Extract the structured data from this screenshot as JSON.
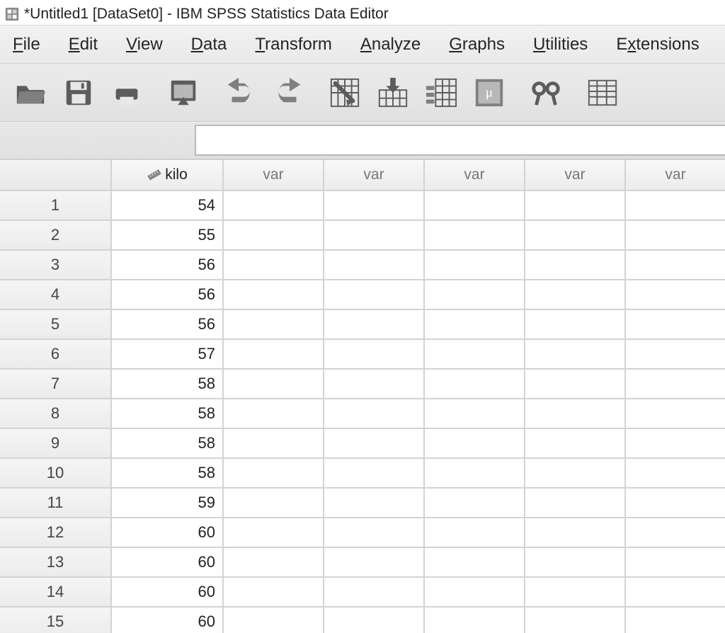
{
  "window": {
    "title": "*Untitled1 [DataSet0] - IBM SPSS Statistics Data Editor"
  },
  "menu": {
    "items": [
      {
        "label": "File",
        "ul": "F"
      },
      {
        "label": "Edit",
        "ul": "E"
      },
      {
        "label": "View",
        "ul": "V"
      },
      {
        "label": "Data",
        "ul": "D"
      },
      {
        "label": "Transform",
        "ul": "T"
      },
      {
        "label": "Analyze",
        "ul": "A"
      },
      {
        "label": "Graphs",
        "ul": "G"
      },
      {
        "label": "Utilities",
        "ul": "U"
      },
      {
        "label": "Extensions",
        "ul": "x"
      }
    ]
  },
  "toolbar": {
    "buttons": [
      "open-file",
      "save",
      "print",
      "sep",
      "recall-dialog",
      "sep",
      "undo",
      "redo",
      "sep",
      "goto-case",
      "goto-variable",
      "variables",
      "run-descriptives",
      "sep",
      "find",
      "sep",
      "value-labels"
    ]
  },
  "valuebar": {
    "value": ""
  },
  "grid": {
    "columns": [
      {
        "name": "kilo",
        "type": "scale"
      },
      {
        "name": "var",
        "placeholder": true
      },
      {
        "name": "var",
        "placeholder": true
      },
      {
        "name": "var",
        "placeholder": true
      },
      {
        "name": "var",
        "placeholder": true
      },
      {
        "name": "var",
        "placeholder": true
      }
    ],
    "rows": [
      {
        "n": 1,
        "kilo": 54
      },
      {
        "n": 2,
        "kilo": 55
      },
      {
        "n": 3,
        "kilo": 56
      },
      {
        "n": 4,
        "kilo": 56
      },
      {
        "n": 5,
        "kilo": 56
      },
      {
        "n": 6,
        "kilo": 57
      },
      {
        "n": 7,
        "kilo": 58
      },
      {
        "n": 8,
        "kilo": 58
      },
      {
        "n": 9,
        "kilo": 58
      },
      {
        "n": 10,
        "kilo": 58
      },
      {
        "n": 11,
        "kilo": 59
      },
      {
        "n": 12,
        "kilo": 60
      },
      {
        "n": 13,
        "kilo": 60
      },
      {
        "n": 14,
        "kilo": 60
      },
      {
        "n": 15,
        "kilo": 60
      }
    ]
  }
}
